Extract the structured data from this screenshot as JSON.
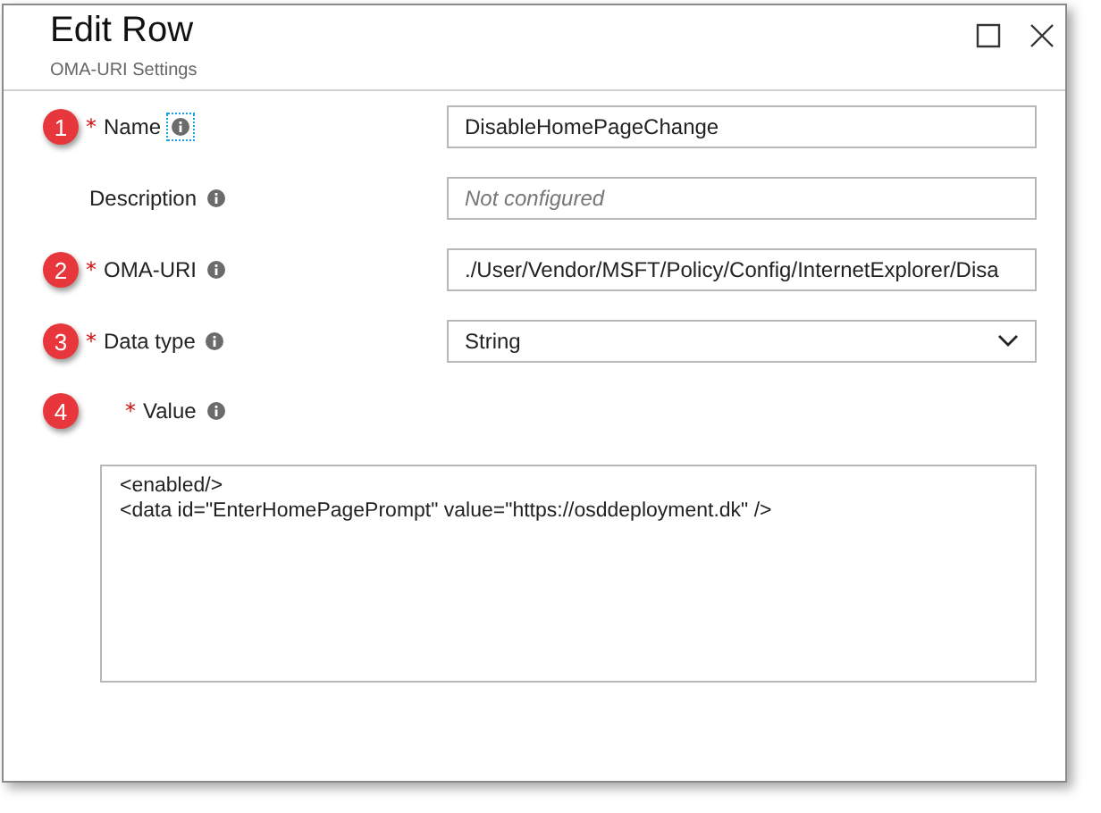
{
  "window": {
    "title": "Edit Row",
    "subtitle": "OMA-URI Settings"
  },
  "fields": [
    {
      "step": "1",
      "required_mark": "*",
      "label": "Name",
      "info_focused": true,
      "kind": "text",
      "value": "DisableHomePageChange"
    },
    {
      "label": "Description",
      "info_focused": false,
      "kind": "text",
      "placeholder": "Not configured"
    },
    {
      "step": "2",
      "required_mark": "*",
      "label": "OMA-URI",
      "info_focused": false,
      "kind": "text",
      "value": "./User/Vendor/MSFT/Policy/Config/InternetExplorer/Disa"
    },
    {
      "step": "3",
      "required_mark": "*",
      "label": "Data type",
      "info_focused": false,
      "kind": "select",
      "value": "String"
    },
    {
      "step": "4",
      "required_mark": "*",
      "label": "Value",
      "info_focused": false,
      "kind": "textarea",
      "lines": [
        "<enabled/>",
        "<data id=\"EnterHomePagePrompt\" value=\"https://osddeployment.dk\" />"
      ]
    }
  ]
}
